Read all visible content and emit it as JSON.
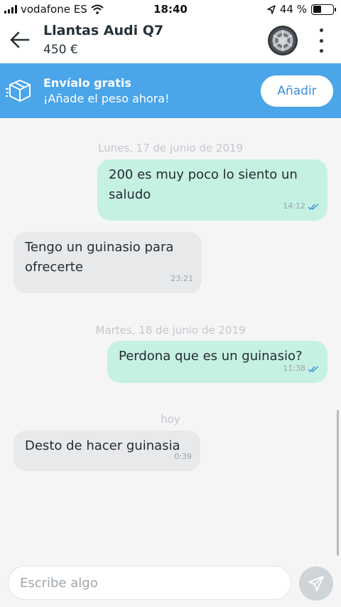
{
  "status_bar": {
    "carrier": "vodafone ES",
    "time": "18:40",
    "battery": "44 %",
    "battery_level": 0.44
  },
  "header": {
    "title": "Llantas Audi Q7",
    "price": "450 €"
  },
  "banner": {
    "title": "Envíalo gratis",
    "subtitle": "¡Añade el peso ahora!",
    "button": "Añadir"
  },
  "chat": {
    "dates": [
      "Lunes, 17 de junio de 2019",
      "Martes, 18 de junio de 2019",
      "hoy"
    ],
    "messages": [
      {
        "direction": "out",
        "text_line1": "200 es muy poco lo siento un",
        "text_line2": "saludo",
        "time": "14:12",
        "read": true
      },
      {
        "direction": "in",
        "text_line1": "Tengo un guinasio para",
        "text_line2": "ofrecerte",
        "time": "23:21"
      },
      {
        "direction": "out",
        "text_line1": "Perdona que es un guinasio?",
        "time": "11:38",
        "read": true
      },
      {
        "direction": "in",
        "text_line1": "Desto de hacer guinasia",
        "time": "0:39"
      }
    ]
  },
  "composer": {
    "placeholder": "Escribe algo"
  },
  "colors": {
    "banner": "#4aa5e9",
    "outgoing_bubble": "#c5f1e3",
    "incoming_bubble": "#e8e9eb",
    "read_ticks": "#3d8ed8"
  }
}
